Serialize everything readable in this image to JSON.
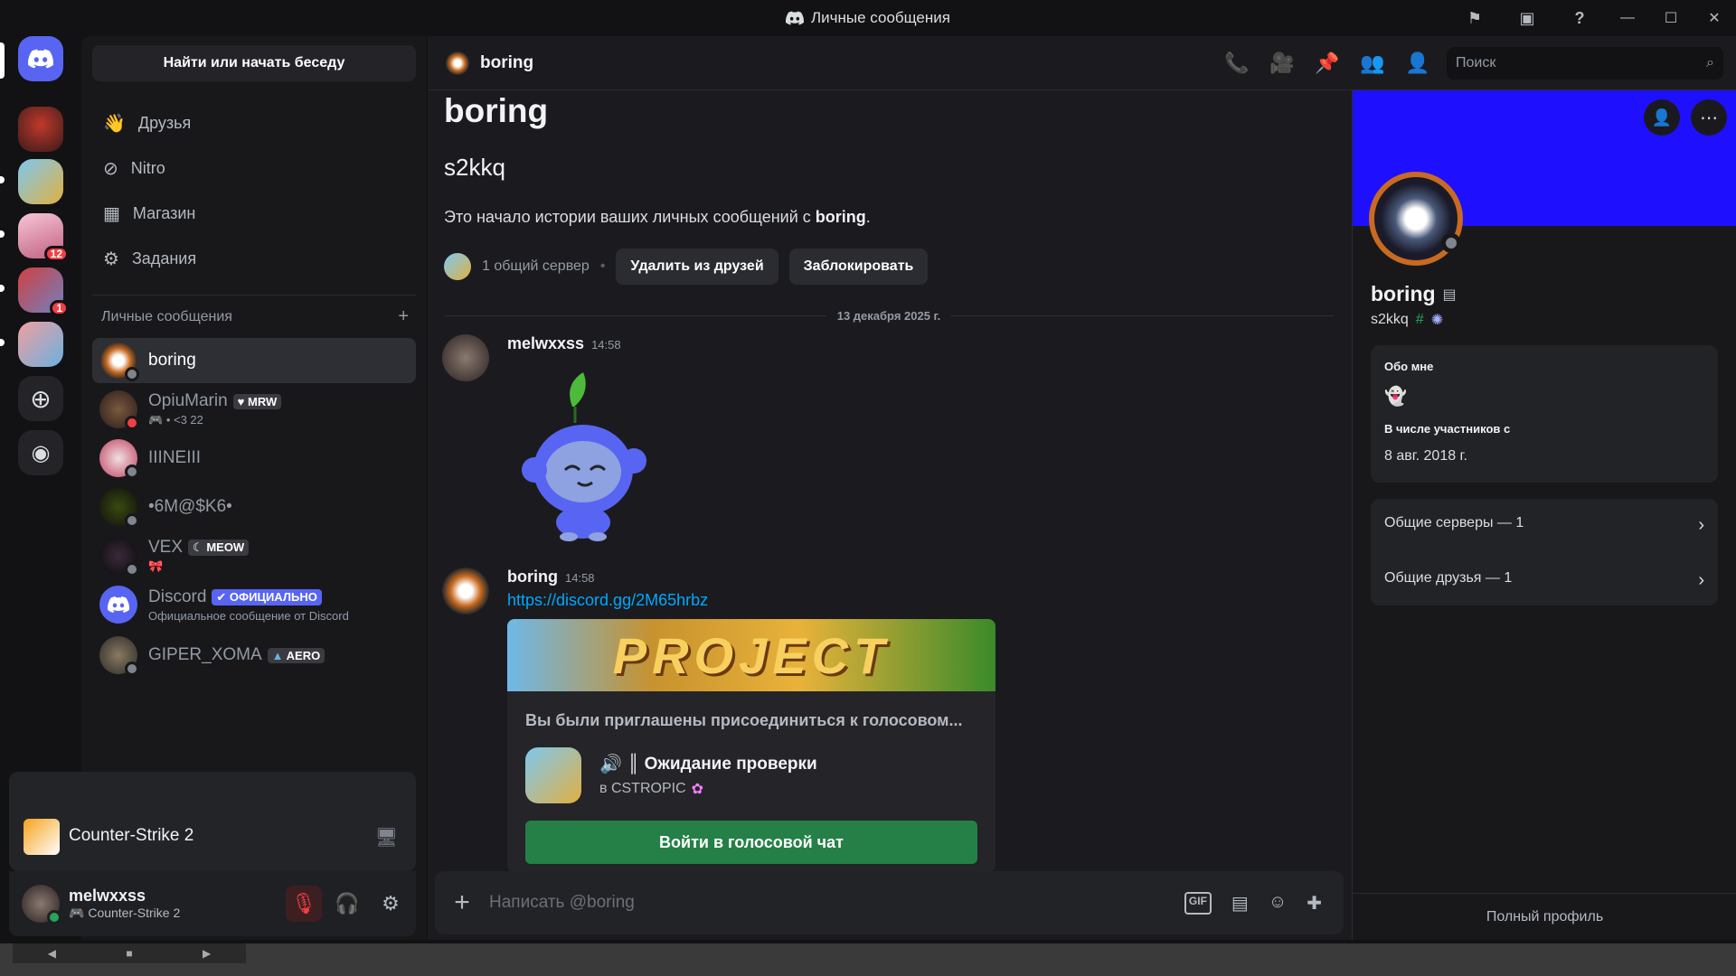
{
  "window": {
    "title": "Личные сообщения"
  },
  "colors": {
    "accent": "#5865f2",
    "banner": "#1f0fff",
    "green": "#248046",
    "online": "#23a55a",
    "offline": "#80848e",
    "dnd": "#f23f43"
  },
  "servers": [
    {
      "name": "server-1",
      "badge": ""
    },
    {
      "name": "server-2",
      "badge": ""
    },
    {
      "name": "server-3",
      "badge": "12"
    },
    {
      "name": "server-4",
      "badge": "1"
    },
    {
      "name": "server-5",
      "badge": ""
    }
  ],
  "sidebar": {
    "find_label": "Найти или начать беседу",
    "nav": [
      {
        "label": "Друзья",
        "icon": "friends-icon"
      },
      {
        "label": "Nitro",
        "icon": "nitro-icon"
      },
      {
        "label": "Магазин",
        "icon": "shop-icon"
      },
      {
        "label": "Задания",
        "icon": "quests-icon"
      }
    ],
    "section_title": "Личные сообщения",
    "section_add": "+",
    "dms": [
      {
        "name": "boring",
        "sub": "",
        "tag": "",
        "status": "offline"
      },
      {
        "name": "OpiuMarin",
        "sub": "• <3 22",
        "tag": "MRW",
        "status": "dnd"
      },
      {
        "name": "IIINEIII",
        "sub": "",
        "tag": "",
        "status": "offline"
      },
      {
        "name": "•6M@$K6•",
        "sub": "",
        "tag": "",
        "status": "offline"
      },
      {
        "name": "VEX",
        "sub": "🎀",
        "tag": "MEOW",
        "status": "offline"
      },
      {
        "name": "Discord",
        "sub": "Официальное сообщение от Discord",
        "tag": "✔ ОФИЦИАЛЬНО",
        "status": ""
      },
      {
        "name": "GIPER_XOMA",
        "sub": "",
        "tag": "AERO",
        "status": "offline"
      }
    ]
  },
  "activity": {
    "game": "Counter-Strike 2"
  },
  "user": {
    "name": "melwxxss",
    "status": "Counter-Strike 2"
  },
  "header": {
    "name": "boring",
    "search_placeholder": "Поиск"
  },
  "intro": {
    "title": "boring",
    "username": "s2kkq",
    "text_prefix": "Это начало истории ваших личных сообщений с ",
    "text_bold": "boring",
    "text_suffix": ".",
    "mutual": "1 общий сервер",
    "remove_friend": "Удалить из друзей",
    "block": "Заблокировать"
  },
  "divider_date": "13 декабря 2025 г.",
  "messages": [
    {
      "author": "melwxxss",
      "time": "14:58"
    },
    {
      "author": "boring",
      "time": "14:58",
      "link": "https://discord.gg/2M65hrbz"
    }
  ],
  "invite": {
    "banner_text": "PROJECT",
    "title": "Вы были приглашены присоединиться к голосовом...",
    "channel": "║ Ожидание проверки",
    "server": "в CSTROPIC",
    "join": "Войти в голосовой чат"
  },
  "composer": {
    "placeholder": "Написать @boring"
  },
  "profile": {
    "display_name": "boring",
    "username": "s2kkq",
    "about_title": "Обо мне",
    "member_since_title": "В числе участников с",
    "member_since": "8 авг. 2018 г.",
    "mutual_servers": "Общие серверы — 1",
    "mutual_friends": "Общие друзья — 1",
    "full_profile": "Полный профиль"
  }
}
